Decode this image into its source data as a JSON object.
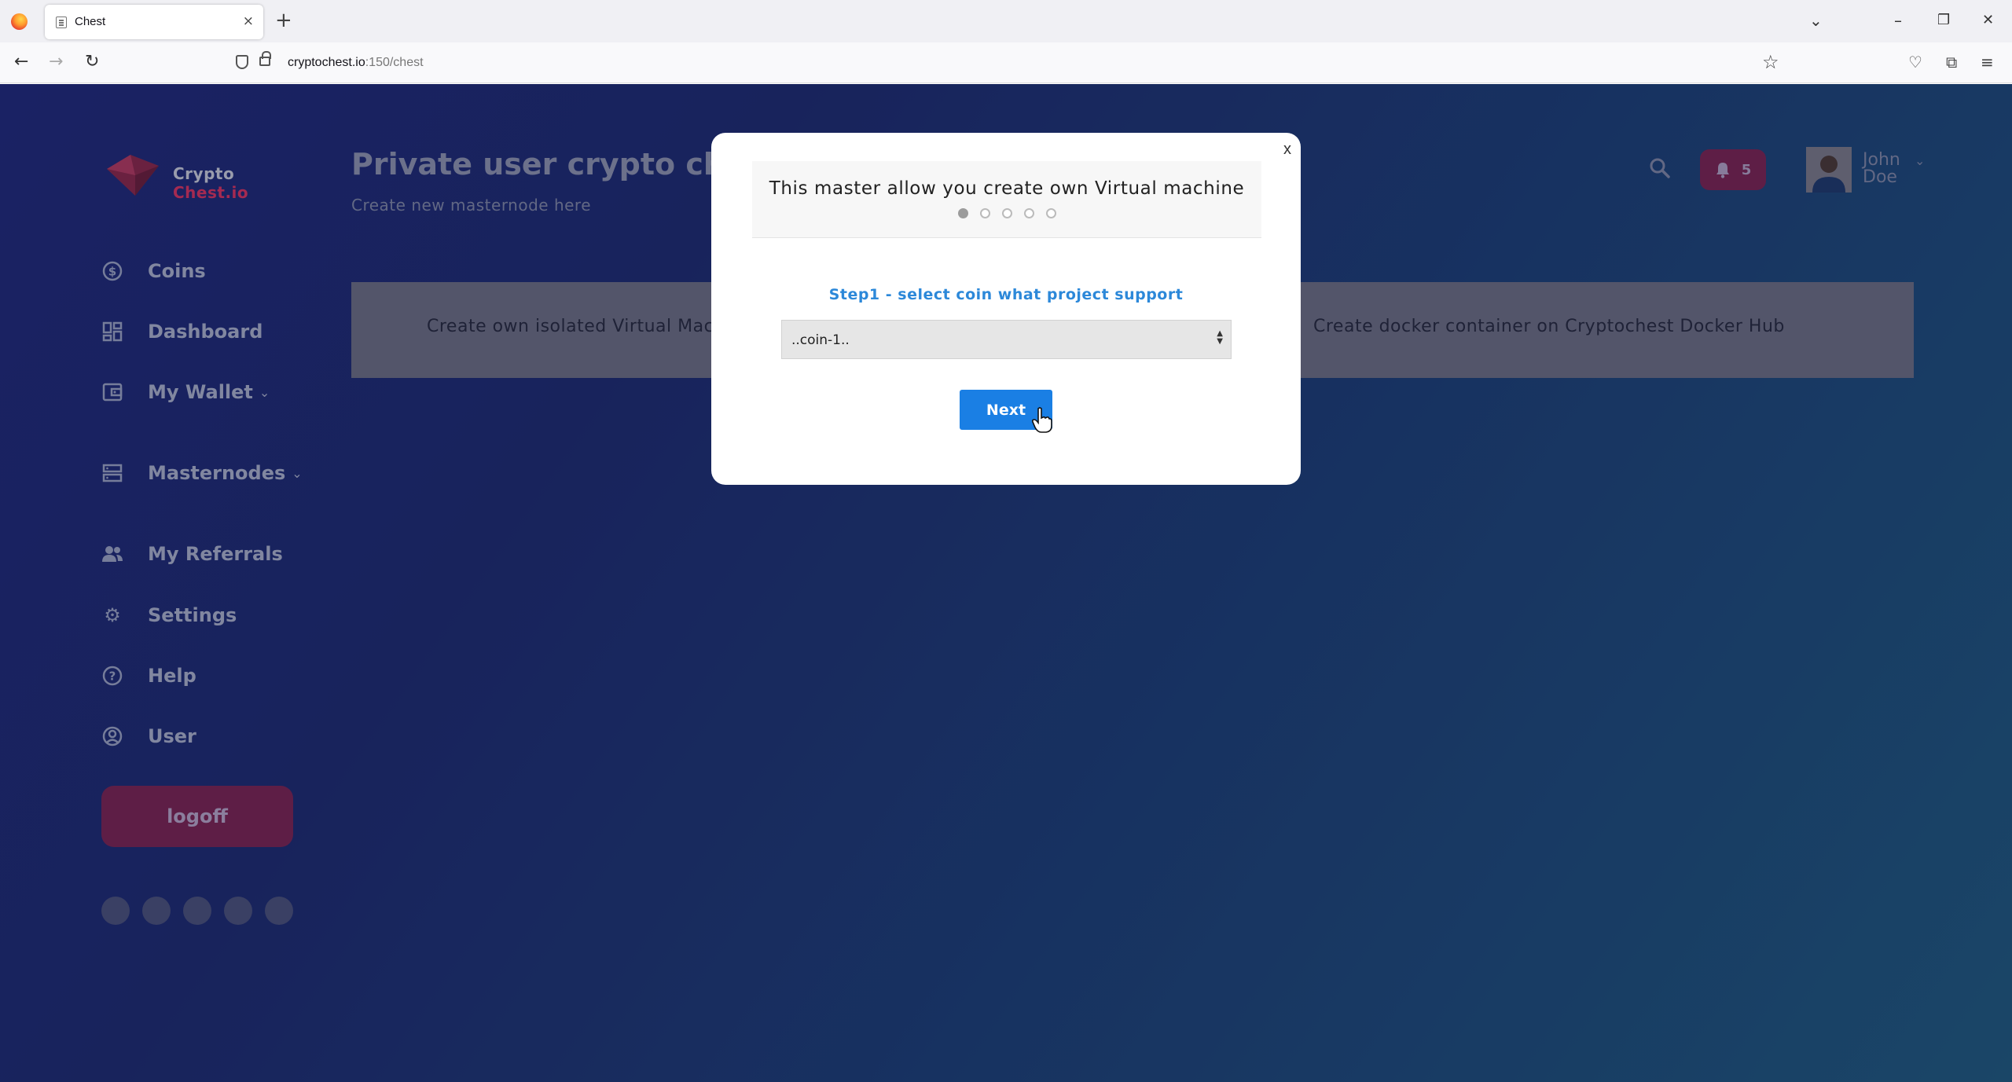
{
  "browser": {
    "tab_title": "Chest",
    "tab_close": "×",
    "new_tab": "+",
    "url_host": "cryptochest.io",
    "url_path": ":150/chest",
    "win_list": "⌄",
    "win_minimize": "–",
    "win_restore": "❐",
    "win_close": "✕"
  },
  "app": {
    "logo_text_main": "Crypto ",
    "logo_text_accent": "Chest.io",
    "page_title": "Private user crypto chest",
    "page_subtitle": "Create new masternode here",
    "sidebar": [
      {
        "label": "Coins",
        "icon": "dollar-circle-icon"
      },
      {
        "label": "Dashboard",
        "icon": "dashboard-grid-icon"
      },
      {
        "label": "My Wallet",
        "icon": "wallet-icon"
      },
      {
        "label": "Masternodes",
        "icon": "server-icon"
      },
      {
        "label": "My Referrals",
        "icon": "users-icon"
      },
      {
        "label": "Settings",
        "icon": "gear-icon"
      },
      {
        "label": "Help",
        "icon": "help-circle-icon"
      },
      {
        "label": "User",
        "icon": "user-circle-icon"
      }
    ],
    "logoff_label": "logoff",
    "notifications_count": "5",
    "user_first": "John",
    "user_last": "Doe",
    "option_vm": "Create own isolated Virtual Mach",
    "option_docker": "Create docker container on Cryptochest Docker Hub"
  },
  "modal": {
    "close_label": "x",
    "title": "This master allow you create own Virtual machine",
    "step_count": 5,
    "active_step": 1,
    "step_label": "Step1 - select coin what project support",
    "select_value": "..coin-1..",
    "next_label": "Next"
  },
  "colors": {
    "accent_blue": "#1a7fe4",
    "accent_red": "#d8345f"
  }
}
